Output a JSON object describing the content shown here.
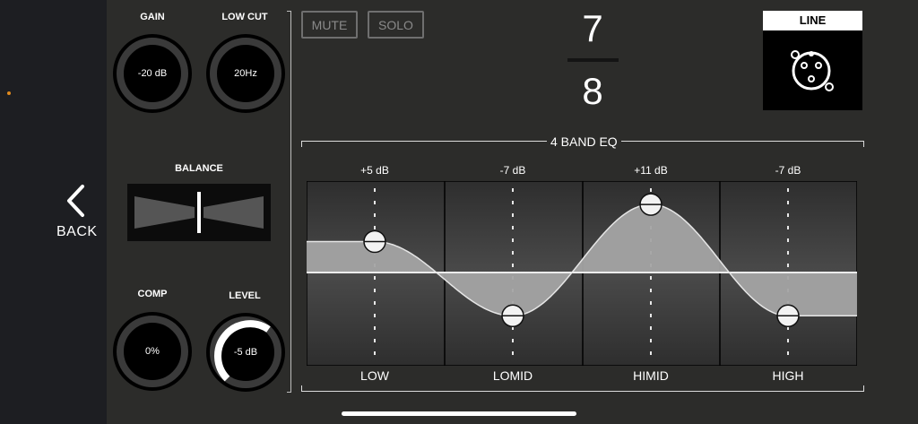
{
  "sidebar": {
    "back_label": "BACK",
    "accent": "#e08a1e"
  },
  "knobs": {
    "gain": {
      "label": "GAIN",
      "value": "-20 dB",
      "fill": 0.0
    },
    "lowcut": {
      "label": "LOW CUT",
      "value": "20Hz",
      "fill": 0.0
    },
    "comp": {
      "label": "COMP",
      "value": "0%",
      "fill": 0.0
    },
    "level": {
      "label": "LEVEL",
      "value": "-5 dB",
      "fill": 0.62
    }
  },
  "balance": {
    "label": "BALANCE",
    "position": 0.0
  },
  "buttons": {
    "mute": "MUTE",
    "solo": "SOLO"
  },
  "channel": {
    "top": "7",
    "bottom": "8"
  },
  "input": {
    "label": "LINE",
    "icon": "xlr-connector-icon"
  },
  "eq": {
    "title": "4 BAND EQ",
    "bands": [
      {
        "name": "LOW",
        "gain_label": "+5 dB",
        "gain": 5
      },
      {
        "name": "LOMID",
        "gain_label": "-7 dB",
        "gain": -7
      },
      {
        "name": "HIMID",
        "gain_label": "+11 dB",
        "gain": 11
      },
      {
        "name": "HIGH",
        "gain_label": "-7 dB",
        "gain": -7
      }
    ]
  }
}
